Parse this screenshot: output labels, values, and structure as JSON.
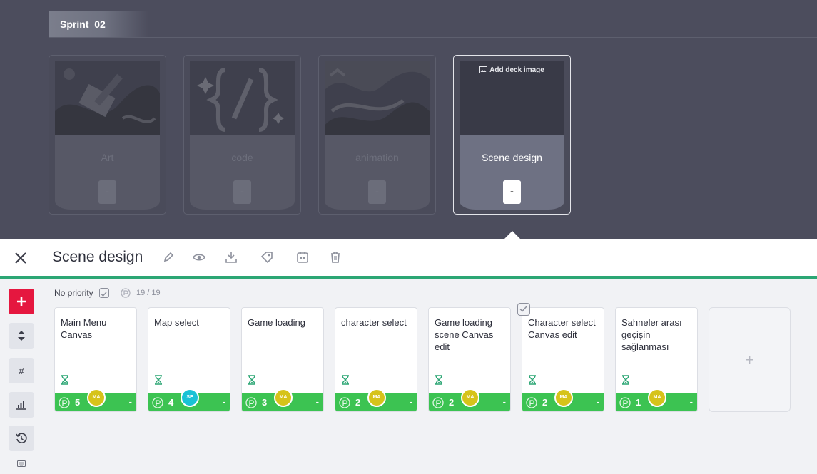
{
  "sprint": {
    "tab_label": "Sprint_02"
  },
  "decks": [
    {
      "name": "Art",
      "minus": "-",
      "active": false
    },
    {
      "name": "code",
      "minus": "-",
      "active": false
    },
    {
      "name": "animation",
      "minus": "-",
      "active": false
    },
    {
      "name": "Scene design",
      "minus": "-",
      "active": true,
      "add_image_label": "Add deck image"
    }
  ],
  "header": {
    "title": "Scene design",
    "tools": [
      "edit-icon",
      "eye-icon",
      "download-icon",
      "tags-icon",
      "calendar-bot-icon",
      "trash-icon"
    ]
  },
  "sidebar": {
    "buttons": [
      "add-icon",
      "sort-icon",
      "hash-icon",
      "chart-icon",
      "history-icon"
    ],
    "keyboard_icon": "keyboard-icon"
  },
  "filter": {
    "priority_label": "No priority",
    "count": "19 / 19"
  },
  "cards": [
    {
      "title": "Main Menu Canvas",
      "points": "5",
      "avatar": "MA",
      "avatar_color": "#d6c31a",
      "minus": "-"
    },
    {
      "title": "Map select",
      "points": "4",
      "avatar": "SE",
      "avatar_color": "#19c2d6",
      "minus": "-"
    },
    {
      "title": "Game loading",
      "points": "3",
      "avatar": "MA",
      "avatar_color": "#d6c31a",
      "minus": "-"
    },
    {
      "title": "character select",
      "points": "2",
      "avatar": "MA",
      "avatar_color": "#d6c31a",
      "minus": "-"
    },
    {
      "title": "Game loading scene Canvas edit",
      "points": "2",
      "avatar": "MA",
      "avatar_color": "#d6c31a",
      "minus": "-"
    },
    {
      "title": "Character select Canvas edit",
      "points": "2",
      "avatar": "MA",
      "avatar_color": "#d6c31a",
      "minus": "-"
    },
    {
      "title": "Sahneler arası geçişin sağlanması",
      "points": "1",
      "avatar": "MA",
      "avatar_color": "#d6c31a",
      "minus": "-"
    }
  ],
  "add_card": {
    "label": "+"
  },
  "colors": {
    "accent_green": "#3cc352",
    "header_line": "#2ba674",
    "add_red": "#e5173f"
  }
}
